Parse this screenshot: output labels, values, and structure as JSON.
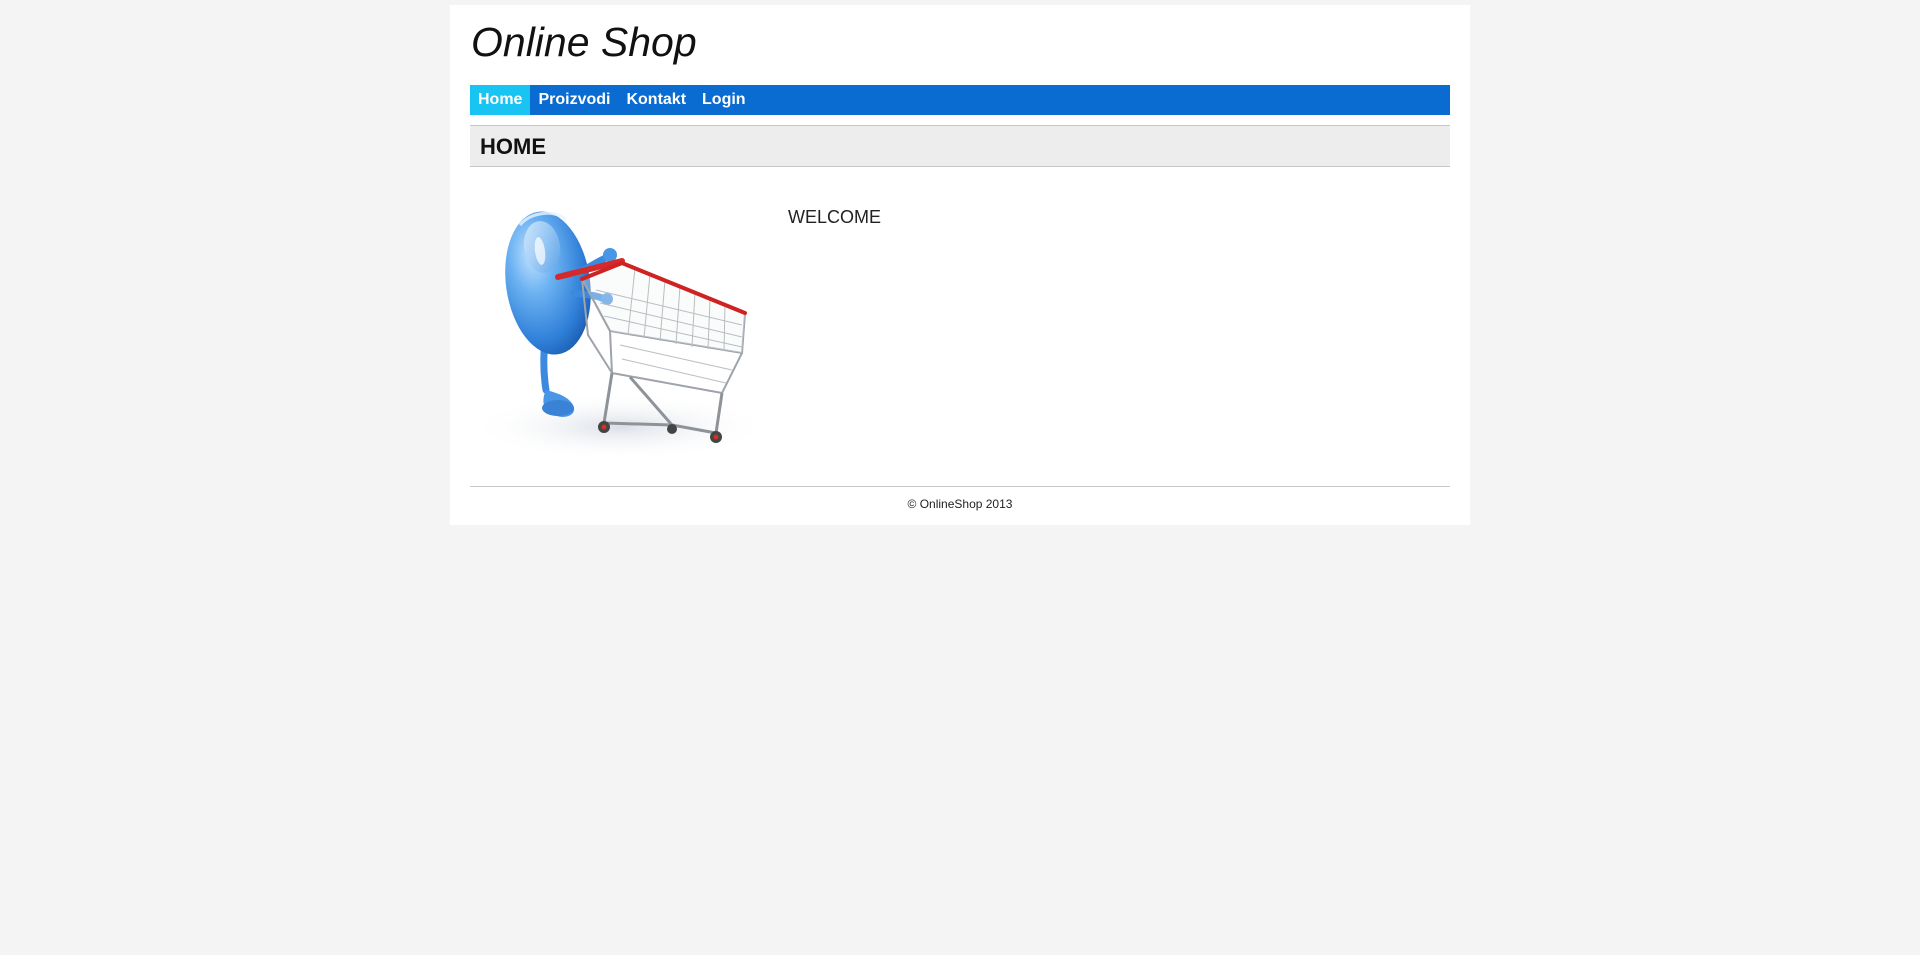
{
  "site": {
    "title": "Online Shop"
  },
  "nav": {
    "items": [
      {
        "label": "Home",
        "active": true
      },
      {
        "label": "Proizvodi",
        "active": false
      },
      {
        "label": "Kontakt",
        "active": false
      },
      {
        "label": "Login",
        "active": false
      }
    ]
  },
  "main": {
    "section_title": "HOME",
    "welcome": "WELCOME",
    "hero_image_icon": "mouse-with-shopping-cart-icon"
  },
  "footer": {
    "copyright": "© OnlineShop 2013"
  },
  "colors": {
    "page_background": "#f4f4f4",
    "nav_background": "#0a6bd1",
    "nav_active": "#19c3f2",
    "section_header_background": "#ededed"
  }
}
